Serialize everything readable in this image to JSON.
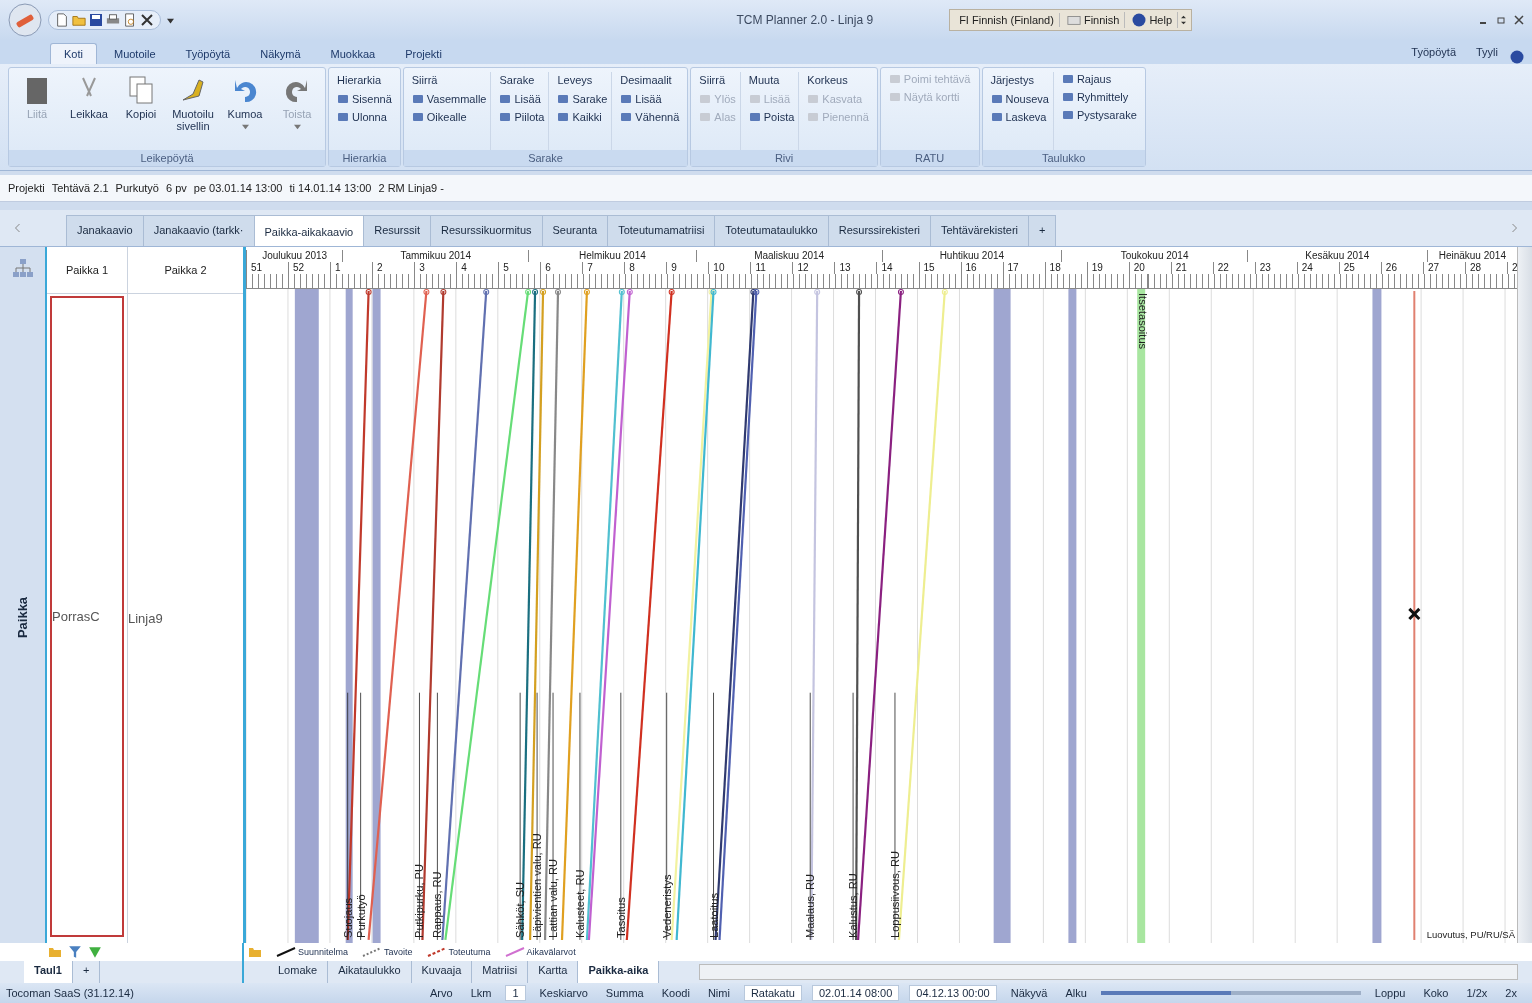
{
  "window": {
    "title": "TCM Planner 2.0 - Linja 9"
  },
  "language_bar": [
    {
      "text": "FI  Finnish (Finland)"
    },
    {
      "text": "Finnish"
    },
    {
      "text": "Help"
    }
  ],
  "ribbon_tabs": [
    {
      "label": "Koti",
      "selected": true
    },
    {
      "label": "Muotoile",
      "selected": false
    },
    {
      "label": "Työpöytä",
      "selected": false
    },
    {
      "label": "Näkymä",
      "selected": false
    },
    {
      "label": "Muokkaa",
      "selected": false
    },
    {
      "label": "Projekti",
      "selected": false
    }
  ],
  "ribbon_right": [
    "Työpöytä",
    "Tyyli"
  ],
  "ribbon_groups": [
    {
      "label": "Leikepöytä",
      "kind": "large",
      "items": [
        {
          "label": "Liitä",
          "disabled": true,
          "dropdown": false
        },
        {
          "label": "Leikkaa",
          "disabled": false,
          "dropdown": false
        },
        {
          "label": "Kopioi",
          "disabled": false,
          "dropdown": false
        },
        {
          "label": "Muotoilu sivellin",
          "disabled": false,
          "dropdown": false
        },
        {
          "label": "Kumoa",
          "disabled": false,
          "dropdown": true
        },
        {
          "label": "Toista",
          "disabled": true,
          "dropdown": true
        }
      ]
    },
    {
      "label": "Hierarkia",
      "kind": "small",
      "columns": [
        {
          "header": "Hierarkia",
          "items": [
            {
              "label": "Sisennä",
              "disabled": false
            },
            {
              "label": "Ulonna",
              "disabled": false
            }
          ]
        }
      ]
    },
    {
      "label": "Sarake",
      "kind": "small",
      "columns": [
        {
          "header": "Siirrä",
          "items": [
            {
              "label": "Vasemmalle",
              "disabled": false
            },
            {
              "label": "Oikealle",
              "disabled": false
            }
          ]
        },
        {
          "header": "Sarake",
          "items": [
            {
              "label": "Lisää",
              "disabled": false
            },
            {
              "label": "Piilota",
              "disabled": false
            }
          ]
        },
        {
          "header": "Leveys",
          "items": [
            {
              "label": "Sarake",
              "disabled": false
            },
            {
              "label": "Kaikki",
              "disabled": false
            }
          ]
        },
        {
          "header": "Desimaalit",
          "items": [
            {
              "label": "Lisää",
              "disabled": false
            },
            {
              "label": "Vähennä",
              "disabled": false
            }
          ]
        }
      ]
    },
    {
      "label": "Rivi",
      "kind": "small",
      "columns": [
        {
          "header": "Siirrä",
          "items": [
            {
              "label": "Ylös",
              "disabled": true
            },
            {
              "label": "Alas",
              "disabled": true
            }
          ]
        },
        {
          "header": "Muuta",
          "items": [
            {
              "label": "Lisää",
              "disabled": true
            },
            {
              "label": "Poista",
              "disabled": false
            }
          ]
        },
        {
          "header": "Korkeus",
          "items": [
            {
              "label": "Kasvata",
              "disabled": true
            },
            {
              "label": "Pienennä",
              "disabled": true
            }
          ]
        }
      ]
    },
    {
      "label": "RATU",
      "kind": "small",
      "columns": [
        {
          "items": [
            {
              "label": "Poimi tehtävä",
              "disabled": true
            },
            {
              "label": "Näytä kortti",
              "disabled": true
            }
          ]
        }
      ]
    },
    {
      "label": "Taulukko",
      "kind": "small",
      "columns": [
        {
          "header": "Järjestys",
          "items": [
            {
              "label": "Nouseva",
              "disabled": false
            },
            {
              "label": "Laskeva",
              "disabled": false
            }
          ]
        },
        {
          "items": [
            {
              "label": "Rajaus",
              "disabled": false
            },
            {
              "label": "Ryhmittely",
              "disabled": false
            },
            {
              "label": "Pystysarake",
              "disabled": false
            }
          ]
        }
      ]
    }
  ],
  "info_line": [
    "Projekti",
    "Tehtävä 2.1",
    "Purkutyö",
    "6 pv",
    "pe 03.01.14 13:00",
    "ti 14.01.14 13:00",
    "2 RM Linja9 -"
  ],
  "view_tabs": [
    {
      "label": "Janakaavio",
      "selected": false
    },
    {
      "label": "Janakaavio (tarkk·",
      "selected": false
    },
    {
      "label": "Paikka-aikakaavio",
      "selected": true
    },
    {
      "label": "Resurssit",
      "selected": false
    },
    {
      "label": "Resurssikuormitus",
      "selected": false
    },
    {
      "label": "Seuranta",
      "selected": false
    },
    {
      "label": "Toteutumamatriisi",
      "selected": false
    },
    {
      "label": "Toteutumataulukko",
      "selected": false
    },
    {
      "label": "Resurssirekisteri",
      "selected": false
    },
    {
      "label": "Tehtävärekisteri",
      "selected": false
    },
    {
      "label": "+",
      "selected": false
    }
  ],
  "side_label": "Paikka",
  "location_columns": [
    {
      "header": "Paikka 1",
      "value": "PorrasC"
    },
    {
      "header": "Paikka 2",
      "value": "Linja9"
    }
  ],
  "months": [
    "Joulukuu 2013",
    "Tammikuu 2014",
    "Helmikuu 2014",
    "Maaliskuu 2014",
    "Huhtikuu 2014",
    "Toukokuu 2014",
    "Kesäkuu 2014",
    "Heinäkuu 2014"
  ],
  "weeks": [
    "51",
    "52",
    "1",
    "2",
    "3",
    "4",
    "5",
    "6",
    "7",
    "8",
    "9",
    "10",
    "11",
    "12",
    "13",
    "14",
    "15",
    "16",
    "17",
    "18",
    "19",
    "20",
    "21",
    "22",
    "23",
    "24",
    "25",
    "26",
    "27",
    "28",
    "2"
  ],
  "flow_lines": [
    {
      "color": "#c0392b"
    },
    {
      "color": "#e06050"
    },
    {
      "color": "#b03a2e"
    },
    {
      "color": "#6070b0"
    },
    {
      "color": "#66dd77"
    },
    {
      "color": "#1a6f80"
    },
    {
      "color": "#d4a020"
    },
    {
      "color": "#888888"
    },
    {
      "color": "#e0a020"
    },
    {
      "color": "#50c0d0"
    },
    {
      "color": "#c060d0"
    },
    {
      "color": "#d03020"
    },
    {
      "color": "#f2f2a0"
    },
    {
      "color": "#40b8d0"
    },
    {
      "color": "#303a70"
    },
    {
      "color": "#5060b0"
    },
    {
      "color": "#c4c4e0"
    },
    {
      "color": "#505050"
    },
    {
      "color": "#8a2080"
    },
    {
      "color": "#eeee90"
    },
    {
      "color": "#e08070"
    }
  ],
  "task_labels": [
    "Suojaus",
    "Purkutyö",
    "Putkipurku, PU",
    "Rappaus, RU",
    "Sähköt, SU",
    "Läpivientien valu, RU",
    "Lattian valu, RU",
    "Kalusteet, RU",
    "Tasoitus",
    "Vedeneristys",
    "Laatoitus",
    "Maalaus, RU",
    "Kalustus, RU",
    "Loppusiivous, RU"
  ],
  "vertical_note": "Itsetasoitus",
  "end_label": "Luovutus, PU/RU/SÄ",
  "legend": [
    {
      "label": "Suunnitelma",
      "kind": "plan"
    },
    {
      "label": "Tavoite",
      "kind": "target"
    },
    {
      "label": "Toteutuma",
      "kind": "actual"
    },
    {
      "label": "Aikavälarvot",
      "kind": "interval"
    }
  ],
  "sheet_tabs_left": [
    {
      "label": "Taul1",
      "selected": true
    },
    {
      "label": "+",
      "selected": false
    }
  ],
  "sheet_tabs": [
    {
      "label": "Lomake",
      "selected": false
    },
    {
      "label": "Aikataulukko",
      "selected": false
    },
    {
      "label": "Kuvaaja",
      "selected": false
    },
    {
      "label": "Matriisi",
      "selected": false
    },
    {
      "label": "Kartta",
      "selected": false
    },
    {
      "label": "Paikka-aika",
      "selected": true
    }
  ],
  "status_bar": {
    "left": "Tocoman SaaS (31.12.14)",
    "items": [
      {
        "text": "Arvo",
        "kind": "label"
      },
      {
        "text": "Lkm",
        "kind": "label"
      },
      {
        "text": "1",
        "kind": "field"
      },
      {
        "text": "Keskiarvo",
        "kind": "label"
      },
      {
        "text": "Summa",
        "kind": "label"
      },
      {
        "text": "Koodi",
        "kind": "label"
      },
      {
        "text": "Nimi",
        "kind": "label"
      },
      {
        "text": "Ratakatu",
        "kind": "field"
      },
      {
        "text": "02.01.14 08:00",
        "kind": "field"
      },
      {
        "text": "04.12.13 00:00",
        "kind": "field"
      },
      {
        "text": "Näkyvä",
        "kind": "label"
      },
      {
        "text": "Alku",
        "kind": "label"
      }
    ],
    "zoom": {
      "level": 0.5
    },
    "right": [
      "Loppu",
      "Koko",
      "1/2x",
      "2x"
    ]
  }
}
